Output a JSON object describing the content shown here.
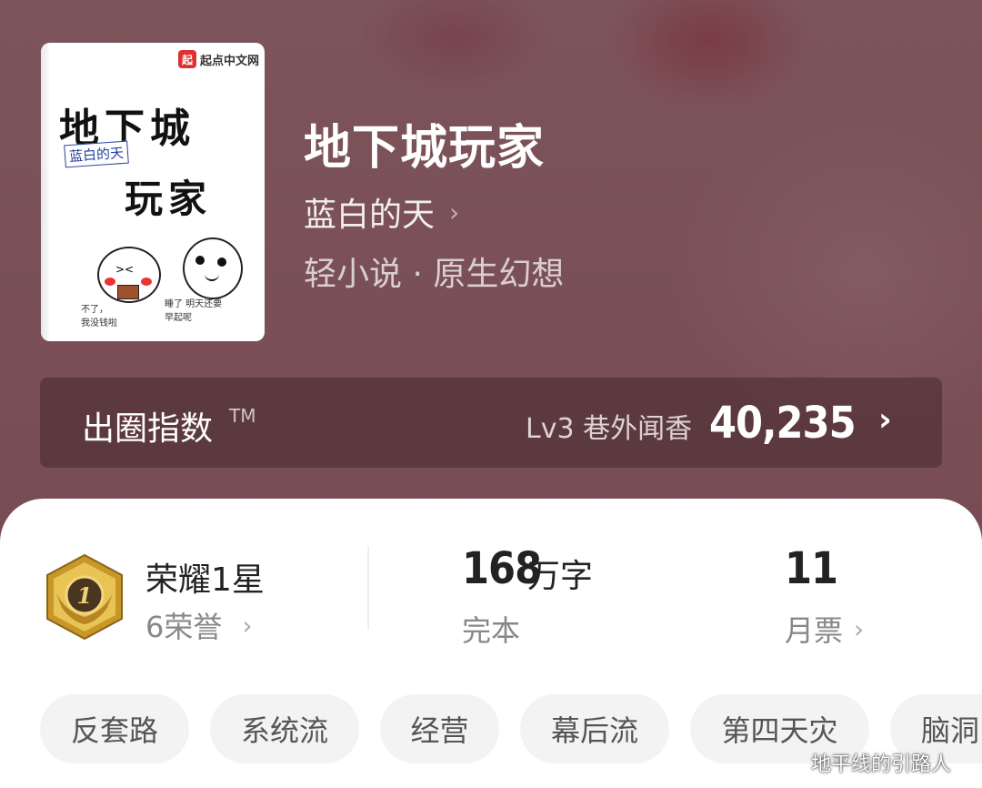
{
  "book": {
    "title": "地下城玩家",
    "author": "蓝白的天",
    "author_chevron": "›",
    "genre": "轻小说 · 原生幻想"
  },
  "cover": {
    "brand": "起点中文网",
    "brand_logo": "起",
    "title_line1": "地下城",
    "title_line2": "玩家",
    "author_tag": "蓝白的天",
    "caption_left": "不了，\n我没钱啦",
    "caption_right": "睡了 明天还要\n早起呢"
  },
  "index": {
    "label": "出圈指数",
    "tm": "TM",
    "level": "Lv3 巷外闻香",
    "value": "40,235",
    "chevron": "›"
  },
  "stats": {
    "honor_title": "荣耀1星",
    "honor_count": "6荣誉",
    "honor_badge_num": "1",
    "words_num": "168",
    "words_unit": "万字",
    "status": "完本",
    "tickets_num": "11",
    "tickets_label": "月票",
    "chevron": "›"
  },
  "tags": [
    "反套路",
    "系统流",
    "经营",
    "幕后流",
    "第四天灾",
    "脑洞"
  ],
  "watermark": "地平线的引路人",
  "colors": {
    "hero_bg": "#7a5057",
    "badge_gold": "#d4a830",
    "badge_dark": "#3a2a1a",
    "tag_bg": "#f3f3f3"
  },
  "icons": [
    "chevron-right-icon",
    "honor-badge-icon",
    "qidian-logo-icon"
  ]
}
